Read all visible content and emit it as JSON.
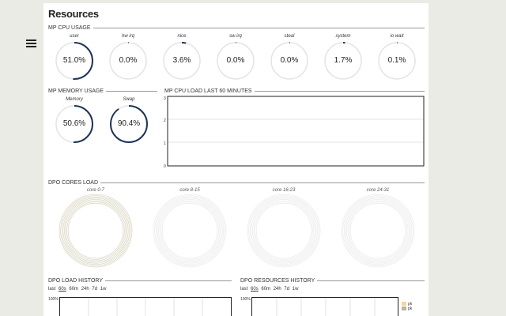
{
  "page": {
    "title": "Resources"
  },
  "sections": {
    "cpu_usage": "MP CPU USAGE",
    "memory_usage": "MP MEMORY USAGE",
    "cpu_load": "MP CPU LOAD LAST 60 MINUTES",
    "cores_load": "DPo CORES LOAD",
    "load_history": "DPo LOAD HISTORY",
    "resources_history": "DPo RESOURCES HISTORY"
  },
  "cpu_gauges": [
    {
      "label": "user",
      "value": "51.0%",
      "fraction": 0.51
    },
    {
      "label": "hw irq",
      "value": "0.0%",
      "fraction": 0.0
    },
    {
      "label": "nice",
      "value": "3.6%",
      "fraction": 0.036
    },
    {
      "label": "sw irq",
      "value": "0.0%",
      "fraction": 0.0
    },
    {
      "label": "steal",
      "value": "0.0%",
      "fraction": 0.0
    },
    {
      "label": "system",
      "value": "1.7%",
      "fraction": 0.017
    },
    {
      "label": "io wait",
      "value": "0.1%",
      "fraction": 0.001
    }
  ],
  "memory_gauges": [
    {
      "label": "Memory",
      "value": "50.6%",
      "fraction": 0.506
    },
    {
      "label": "Swap",
      "value": "90.4%",
      "fraction": 0.904
    }
  ],
  "cpu_load_chart": {
    "y_ticks": [
      "3",
      "2",
      "1",
      "0"
    ]
  },
  "cores": [
    {
      "label": "core 0-7"
    },
    {
      "label": "core 8-15"
    },
    {
      "label": "core 16-23"
    },
    {
      "label": "core 24-31"
    }
  ],
  "load_history": {
    "timeframes": [
      "last",
      "60s",
      "60m",
      "24h",
      "7d",
      "1w"
    ],
    "active": "60s",
    "y_top": "100%"
  },
  "resources_history": {
    "timeframes": [
      "last",
      "60s",
      "60m",
      "24h",
      "7d",
      "1w"
    ],
    "active": "60s",
    "y_top": "100%",
    "legend": [
      {
        "label": "pk",
        "color": "#f2d89a"
      },
      {
        "label": "pk",
        "color": "#bdb79a"
      }
    ]
  },
  "colors": {
    "gauge_arc": "#1f3556",
    "gauge_track": "#e4e4e4",
    "page_bg": "#e9ebe4"
  },
  "icons": {
    "menu": "hamburger-menu-icon"
  }
}
